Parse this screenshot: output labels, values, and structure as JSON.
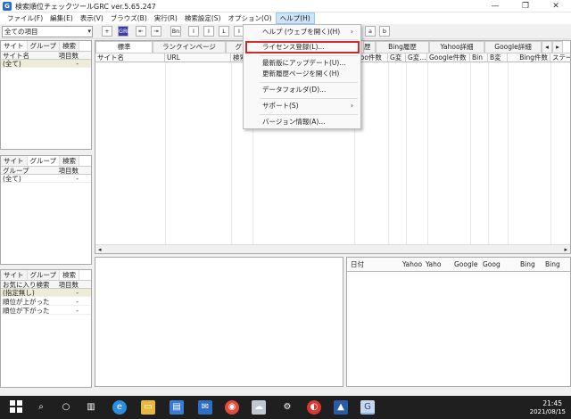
{
  "window": {
    "title": "検索順位チェックツールGRC  ver.5.65.247",
    "app_icon": "G",
    "minimize": "—",
    "maximize": "❐",
    "close": "✕"
  },
  "menu": [
    "ファイル(F)",
    "編集(E)",
    "表示(V)",
    "ブラウズ(B)",
    "実行(R)",
    "検索設定(S)",
    "オプション(O)",
    "ヘルプ(H)"
  ],
  "toolbar": {
    "combo_value": "全ての項目",
    "buttons": [
      "+",
      "GRC",
      "⇤",
      "⇥",
      "Bn",
      "I",
      "I",
      "L",
      "I"
    ],
    "right_buttons": [
      "a",
      "b"
    ]
  },
  "panel_sites": {
    "tabs": [
      "サイト",
      "グループ",
      "検索"
    ],
    "headers": [
      "サイト名",
      "項目数"
    ],
    "rows": [
      {
        "name": "(全て)",
        "count": "-"
      }
    ]
  },
  "panel_groups": {
    "tabs": [
      "サイト",
      "グループ",
      "検索"
    ],
    "headers": [
      "グループ",
      "項目数"
    ],
    "rows": [
      {
        "name": "(全て)",
        "count": "-"
      }
    ]
  },
  "panel_search": {
    "tabs": [
      "サイト",
      "グループ",
      "検索"
    ],
    "headers": [
      "お気に入り検索",
      "項目数"
    ],
    "rows": [
      {
        "name": "(指定無し)",
        "count": "-"
      },
      {
        "name": "順位が上がった",
        "count": "-"
      },
      {
        "name": "順位が下がった",
        "count": "-"
      }
    ]
  },
  "main_tabs": [
    "標準",
    "ランクインページ",
    "グラ",
    "歴",
    "Bing履歴",
    "Yahoo詳細",
    "Google詳細"
  ],
  "main_headers": [
    "サイト名",
    "URL",
    "検索",
    "",
    "",
    "hoo件数",
    "G変",
    "G変...",
    "Google件数",
    "Bin",
    "B変",
    "Bing件数",
    "ステー"
  ],
  "help_menu": {
    "items": [
      {
        "label": "ヘルプ (ウェブを開く)(H)",
        "arrow": "›"
      },
      {
        "label": "ライセンス登録(L)...",
        "arrow": ""
      },
      {
        "label": "最新版にアップデート(U)...",
        "arrow": ""
      },
      {
        "label": "更新履歴ページを開く(H)",
        "arrow": ""
      },
      {
        "label": "データフォルダ(D)...",
        "arrow": ""
      },
      {
        "label": "サポート(S)",
        "arrow": "›"
      },
      {
        "label": "バージョン情報(A)...",
        "arrow": ""
      }
    ]
  },
  "history_headers": [
    "日付",
    "Yahoo",
    "Yaho",
    "Google",
    "Goog",
    "Bing",
    "Bing"
  ],
  "taskbar": {
    "time": "21:45",
    "date": "2021/08/15",
    "icons": [
      "windows-icon",
      "search-icon",
      "cortana-icon",
      "taskview-icon",
      "edge-icon",
      "explorer-icon",
      "store-icon",
      "mail-icon",
      "chrome-icon",
      "cloud-icon",
      "settings-icon",
      "app-icon",
      "photos-icon",
      "grc-icon"
    ]
  },
  "colors": {
    "highlight_border": "#d12a2a",
    "taskbar": "#1f1f1f",
    "row_highlight": "#eeebd6"
  }
}
